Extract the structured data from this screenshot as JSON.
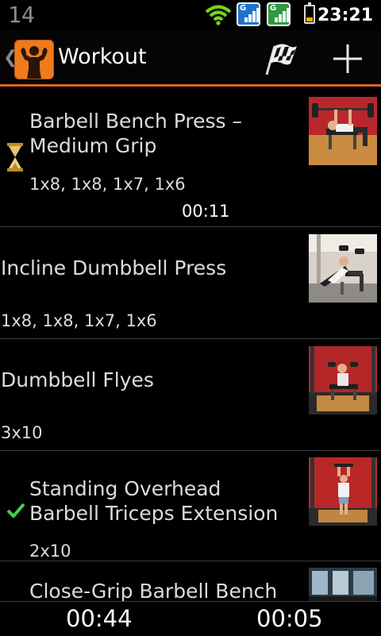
{
  "status_bar": {
    "left_number": "14",
    "time": "23:21",
    "signal_badge_1": "G",
    "signal_badge_2": "G",
    "icons": [
      "wifi-icon",
      "signal-icon",
      "signal-icon",
      "battery-icon"
    ]
  },
  "action_bar": {
    "title": "Workout",
    "accent_color": "#e0631c",
    "actions": [
      "finish-flag-icon",
      "add-icon"
    ]
  },
  "exercises": [
    {
      "name": "Barbell Bench Press – Medium Grip",
      "sets": "1x8, 1x8, 1x7, 1x6",
      "timer": "00:11",
      "status": "in-progress"
    },
    {
      "name": "Incline Dumbbell Press",
      "sets": "1x8, 1x8, 1x7, 1x6",
      "status": "none"
    },
    {
      "name": "Dumbbell Flyes",
      "sets": "3x10",
      "status": "none"
    },
    {
      "name": "Standing Overhead Barbell Triceps Extension",
      "sets": "2x10",
      "status": "done"
    },
    {
      "name": "Close-Grip Barbell Bench",
      "status": "none"
    }
  ],
  "bottom_bar": {
    "left_timer": "00:44",
    "right_timer": "00:05"
  }
}
